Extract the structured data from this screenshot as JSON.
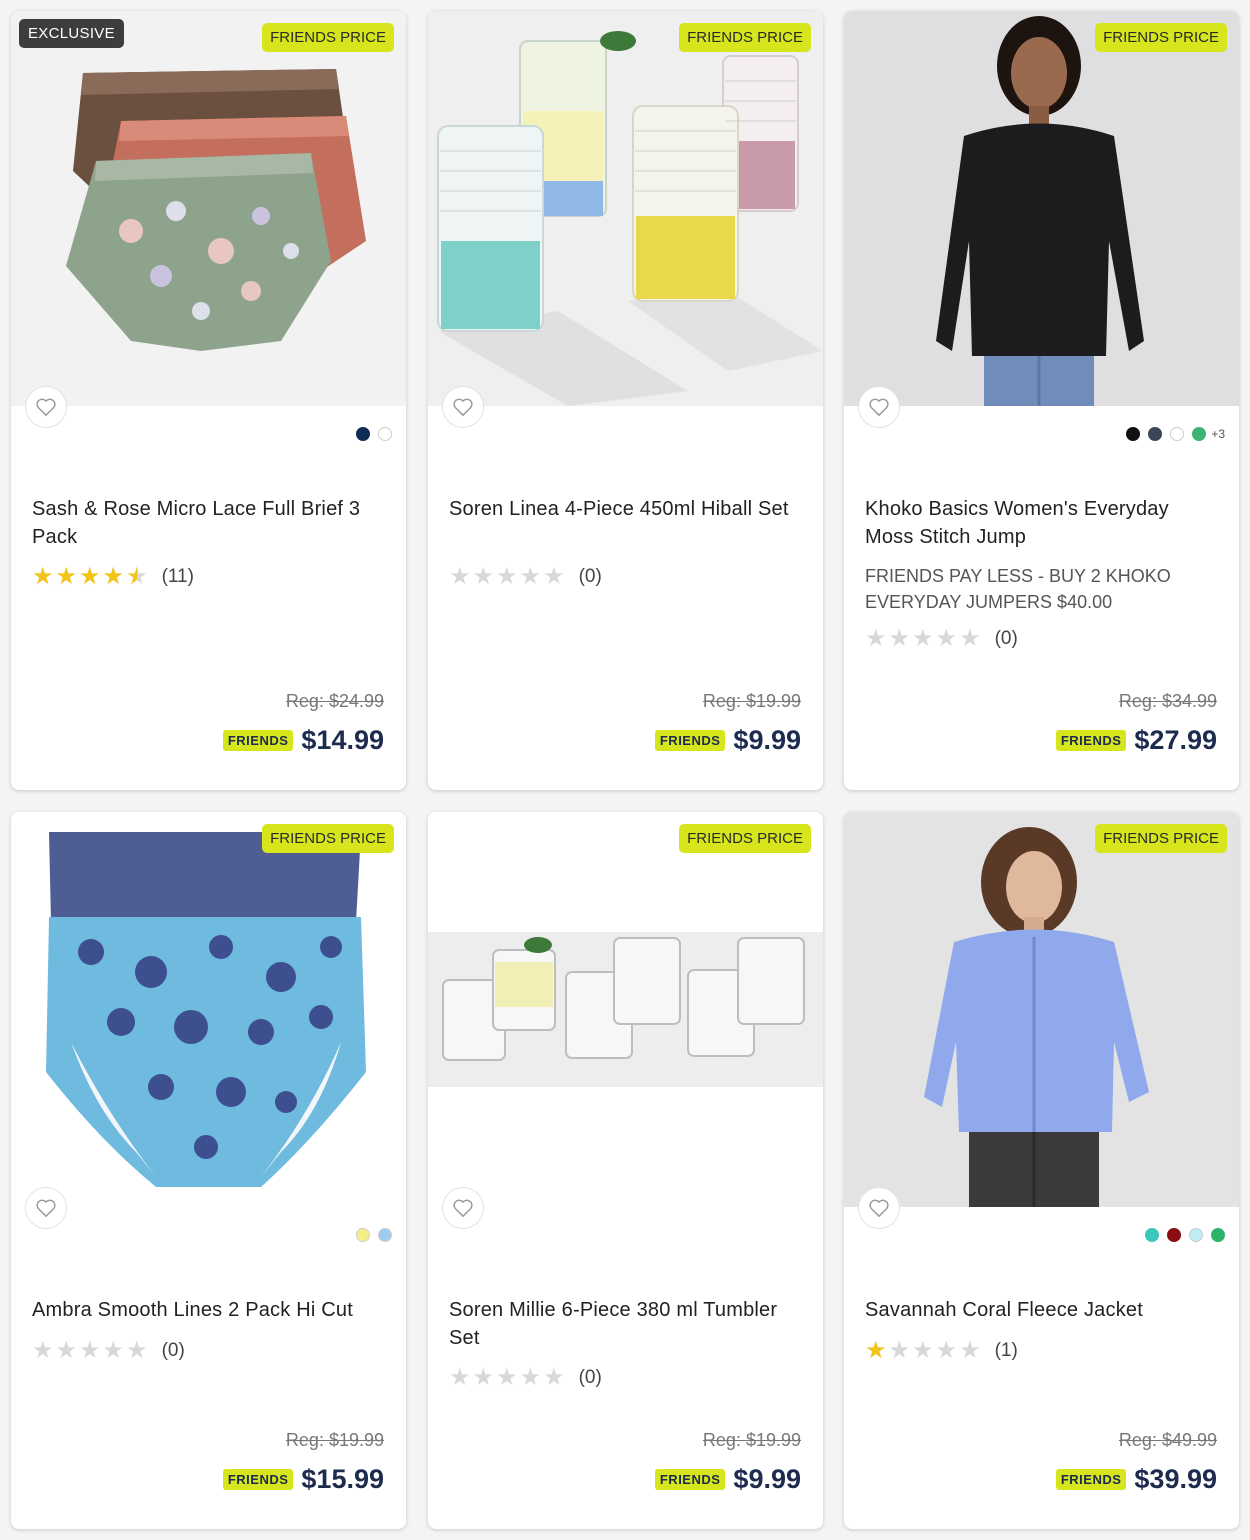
{
  "products": [
    {
      "badge_exclusive": "EXCLUSIVE",
      "badge_friends": "FRIENDS PRICE",
      "title": "Sash & Rose Micro Lace Full Brief 3 Pack",
      "promo": "",
      "rating": 4.5,
      "rating_count": "(11)",
      "reg_price": "Reg: $24.99",
      "friends_tag": "FRIENDS",
      "price": "$14.99",
      "swatches": [
        "#0e2b55",
        "#ffffff"
      ],
      "more_colors": ""
    },
    {
      "badge_exclusive": "",
      "badge_friends": "FRIENDS PRICE",
      "title": "Soren Linea 4-Piece 450ml Hiball Set",
      "promo": "",
      "rating": 0,
      "rating_count": "(0)",
      "reg_price": "Reg: $19.99",
      "friends_tag": "FRIENDS",
      "price": "$9.99",
      "swatches": [],
      "more_colors": ""
    },
    {
      "badge_exclusive": "",
      "badge_friends": "FRIENDS PRICE",
      "title": "Khoko Basics Women's Everyday Moss Stitch Jump",
      "promo": "FRIENDS PAY LESS - BUY 2 KHOKO EVERYDAY JUMPERS $40.00",
      "rating": 0,
      "rating_count": "(0)",
      "reg_price": "Reg: $34.99",
      "friends_tag": "FRIENDS",
      "price": "$27.99",
      "swatches": [
        "#111111",
        "#3b4756",
        "#ffffff",
        "#3cb371"
      ],
      "more_colors": "+3"
    },
    {
      "badge_exclusive": "",
      "badge_friends": "FRIENDS PRICE",
      "title": "Ambra Smooth Lines 2 Pack Hi Cut",
      "promo": "",
      "rating": 0,
      "rating_count": "(0)",
      "reg_price": "Reg: $19.99",
      "friends_tag": "FRIENDS",
      "price": "$15.99",
      "swatches": [
        "#f5ef8a",
        "#9ecbef"
      ],
      "more_colors": ""
    },
    {
      "badge_exclusive": "",
      "badge_friends": "FRIENDS PRICE",
      "title": "Soren Millie 6-Piece 380 ml Tumbler Set",
      "promo": "",
      "rating": 0,
      "rating_count": "(0)",
      "reg_price": "Reg: $19.99",
      "friends_tag": "FRIENDS",
      "price": "$9.99",
      "swatches": [],
      "more_colors": ""
    },
    {
      "badge_exclusive": "",
      "badge_friends": "FRIENDS PRICE",
      "title": "Savannah Coral Fleece Jacket",
      "promo": "",
      "rating": 1,
      "rating_count": "(1)",
      "reg_price": "Reg: $49.99",
      "friends_tag": "FRIENDS",
      "price": "$39.99",
      "swatches": [
        "#3cc7bd",
        "#8b0d12",
        "#bfeef5",
        "#2fb36b"
      ],
      "more_colors": ""
    }
  ],
  "icons": {
    "wishlist": "heart-outline-icon",
    "star": "star-icon"
  }
}
